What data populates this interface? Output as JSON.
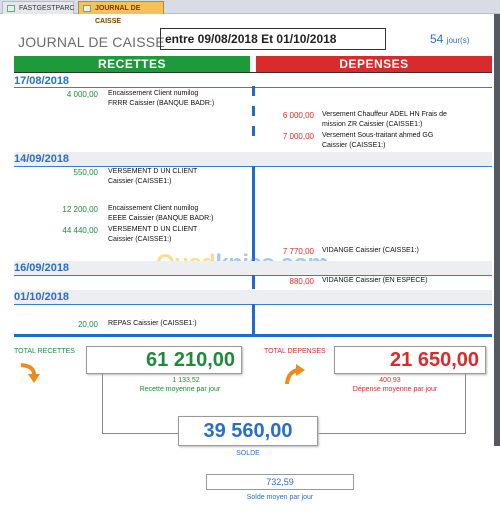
{
  "tabs": [
    {
      "label": "FASTGESTPARC"
    },
    {
      "label": "JOURNAL DE CAISSE"
    }
  ],
  "title": "JOURNAL DE CAISSE",
  "period": "entre 09/08/2018 Et 01/10/2018",
  "days": {
    "count": "54",
    "unit": "jour(s)"
  },
  "headers": {
    "recettes": "RECETTES",
    "depenses": "DEPENSES"
  },
  "sections": [
    {
      "date": "17/08/2018",
      "recettes": [
        {
          "amount": "4 000,00",
          "line1": "Encaissement  Client numilog",
          "line2": "FRRR Caissier  (BANQUE BADR:)"
        }
      ],
      "depenses": [
        {
          "amount": "6 000,00",
          "line1": "Versement  Chauffeur  ADEL HN  Frais de",
          "line2": "mission  ZR Caissier  (CAISSE1:)"
        },
        {
          "amount": "7 000,00",
          "line1": "Versement  Sous-traitant  ahmed  GG",
          "line2": "Caissier  (CAISSE1:)"
        }
      ]
    },
    {
      "date": "14/09/2018",
      "recettes": [
        {
          "amount": "550,00",
          "line1": "VERSEMENT D UN CLIENT",
          "line2": "Caissier  (CAISSE1:)"
        },
        {
          "amount": "12 200,00",
          "line1": "Encaissement  Client numilog",
          "line2": "EEEE Caissier  (BANQUE BADR:)"
        },
        {
          "amount": "44 440,00",
          "line1": "VERSEMENT D UN CLIENT",
          "line2": "Caissier  (CAISSE1:)"
        }
      ],
      "depenses": [
        {
          "amount": "7 770,00",
          "line1": "VIDANGE      Caissier  (CAISSE1:)"
        }
      ]
    },
    {
      "date": "16/09/2018",
      "recettes": [],
      "depenses": [
        {
          "amount": "880,00",
          "line1": "VIDANGE      Caissier  (EN ESPECE)"
        }
      ]
    },
    {
      "date": "01/10/2018",
      "recettes": [
        {
          "amount": "20,00",
          "line1": "REPAS      Caissier  (CAISSE1:)"
        }
      ],
      "depenses": []
    }
  ],
  "totals": {
    "recettes_label": "TOTAL RECETTES",
    "recettes_value": "61 210,00",
    "recettes_avg": "1 133,52",
    "recettes_avg_label": "Recette moyenne par jour",
    "depenses_label": "TOTAL DEPENSES",
    "depenses_value": "21 650,00",
    "depenses_avg": "400,93",
    "depenses_avg_label": "Dépense moyenne par jour",
    "solde_value": "39 560,00",
    "solde_label": "SOLDE",
    "solde_avg": "732,59",
    "solde_avg_label": "Solde moyen par jour"
  },
  "watermark": {
    "part1": "Oued",
    "part2": "kniss",
    "part3": ".com"
  },
  "colors": {
    "recettes": "#1f9a3a",
    "depenses": "#d82b2b",
    "accent": "#2a6fc4",
    "arrow": "#f08a1c"
  }
}
